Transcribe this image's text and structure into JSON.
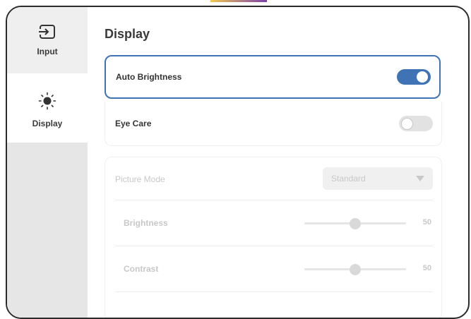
{
  "sidebar": {
    "items": [
      {
        "label": "Input",
        "icon": "input-icon",
        "active": false
      },
      {
        "label": "Display",
        "icon": "brightness-icon",
        "active": true
      }
    ]
  },
  "page": {
    "title": "Display"
  },
  "settings": {
    "auto_brightness": {
      "label": "Auto Brightness",
      "enabled": true
    },
    "eye_care": {
      "label": "Eye Care",
      "enabled": false
    }
  },
  "picture": {
    "mode_label": "Picture Mode",
    "mode_value": "Standard",
    "brightness": {
      "label": "Brightness",
      "value": "50",
      "level": 0.5
    },
    "contrast": {
      "label": "Contrast",
      "value": "50",
      "level": 0.5
    }
  },
  "colors": {
    "accent": "#3f73b6",
    "sidebar_bg": "#efefef",
    "disabled_text": "#c8c8c8"
  }
}
